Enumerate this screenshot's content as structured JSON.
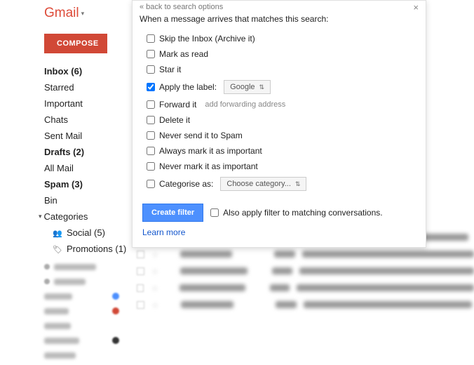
{
  "logo": {
    "text": "Gmail"
  },
  "compose": "COMPOSE",
  "nav": {
    "inbox": "Inbox (6)",
    "starred": "Starred",
    "important": "Important",
    "chats": "Chats",
    "sent": "Sent Mail",
    "drafts": "Drafts (2)",
    "allmail": "All Mail",
    "spam": "Spam (3)",
    "bin": "Bin",
    "categories": "Categories",
    "social": "Social (5)",
    "promotions": "Promotions (1)"
  },
  "dialog": {
    "back": "« back to search options",
    "desc": "When a message arrives that matches this search:",
    "skip": "Skip the Inbox (Archive it)",
    "markread": "Mark as read",
    "star": "Star it",
    "apply": "Apply the label:",
    "apply_value": "Google",
    "forward": "Forward it",
    "forward_add": "add forwarding address",
    "delete": "Delete it",
    "neverspam": "Never send it to Spam",
    "alwaysimportant": "Always mark it as important",
    "neverimportant": "Never mark it as important",
    "categorise": "Categorise as:",
    "categorise_value": "Choose category...",
    "create": "Create filter",
    "alsoapply": "Also apply filter to matching conversations.",
    "learnmore": "Learn more"
  }
}
